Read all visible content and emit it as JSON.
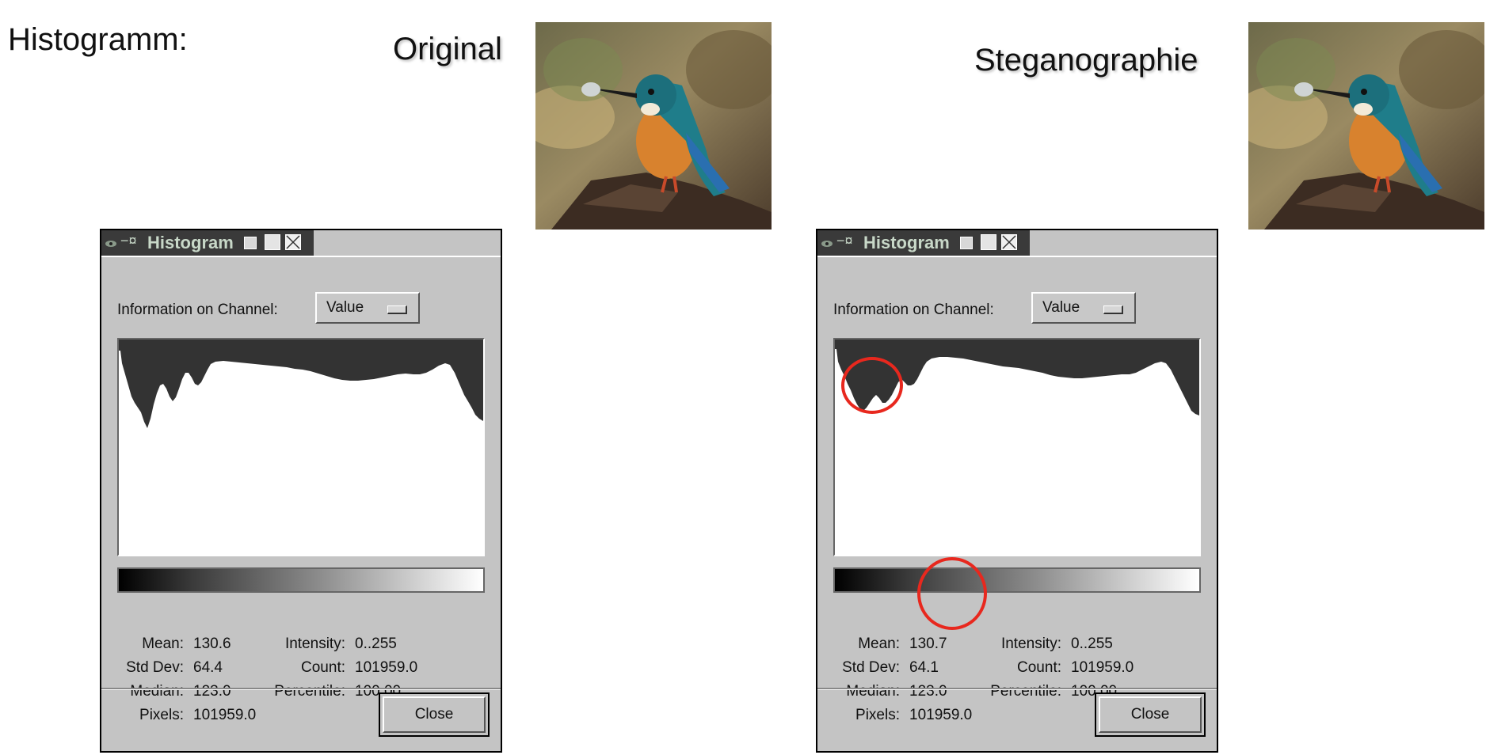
{
  "slide": {
    "title": "Histogramm:",
    "original_label": "Original",
    "stego_label": "Steganographie"
  },
  "windows": [
    {
      "id": "original",
      "title": "Histogram",
      "channel_label": "Information on Channel:",
      "channel_value": "Value",
      "stats": {
        "mean_label": "Mean:",
        "mean": "130.6",
        "stddev_label": "Std Dev:",
        "stddev": "64.4",
        "median_label": "Median:",
        "median": "123.0",
        "pixels_label": "Pixels:",
        "pixels": "101959.0",
        "intensity_label": "Intensity:",
        "intensity": "0..255",
        "count_label": "Count:",
        "count": "101959.0",
        "percentile_label": "Percentile:",
        "percentile": "100.00"
      },
      "close_label": "Close"
    },
    {
      "id": "stego",
      "title": "Histogram",
      "channel_label": "Information on Channel:",
      "channel_value": "Value",
      "stats": {
        "mean_label": "Mean:",
        "mean": "130.7",
        "stddev_label": "Std Dev:",
        "stddev": "64.1",
        "median_label": "Median:",
        "median": "123.0",
        "pixels_label": "Pixels:",
        "pixels": "101959.0",
        "intensity_label": "Intensity:",
        "intensity": "0..255",
        "count_label": "Count:",
        "count": "101959.0",
        "percentile_label": "Percentile:",
        "percentile": "100.00"
      },
      "close_label": "Close"
    }
  ],
  "colors": {
    "window_bg": "#c4c4c4",
    "titlebar": "#3a3a3a",
    "histogram_fill": "#333333",
    "highlight": "#e8281e"
  },
  "icons": [
    "gimp-eye-icon",
    "pin-icon",
    "minimize-icon",
    "maximize-icon",
    "close-icon"
  ]
}
